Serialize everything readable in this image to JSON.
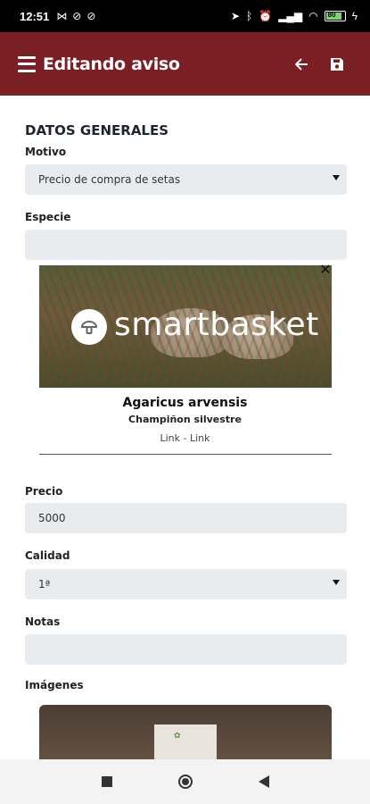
{
  "status_bar": {
    "time": "12:51",
    "battery_level": "80"
  },
  "app_bar": {
    "title": "Editando aviso"
  },
  "form": {
    "section_title": "DATOS GENERALES",
    "motivo": {
      "label": "Motivo",
      "value": "Precio de compra de setas"
    },
    "especie": {
      "label": "Especie",
      "value": ""
    },
    "species_card": {
      "logo_text": "smartbasket",
      "scientific_name": "Agaricus arvensis",
      "common_name": "Champiñon silvestre",
      "link1": "Link",
      "separator": " - ",
      "link2": "Link"
    },
    "precio": {
      "label": "Precio",
      "value": "5000"
    },
    "calidad": {
      "label": "Calidad",
      "value": "1ª"
    },
    "notas": {
      "label": "Notas",
      "value": ""
    },
    "imagenes": {
      "label": "Imágenes"
    }
  },
  "colors": {
    "app_bar": "#7a1f24",
    "field_bg": "#e9ecef"
  }
}
